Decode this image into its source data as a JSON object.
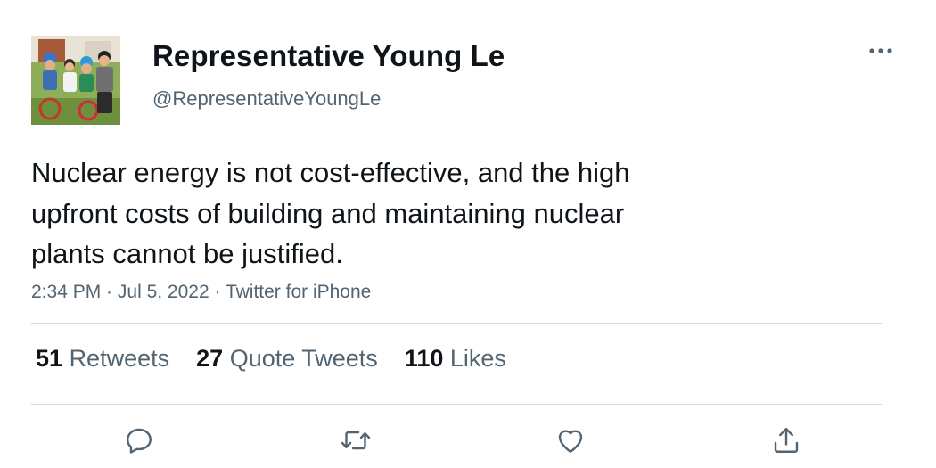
{
  "author": {
    "display_name": "Representative Young Le",
    "handle": "@RepresentativeYoungLe"
  },
  "tweet": {
    "text_lines": [
      "Nuclear energy is not cost-effective, and the high",
      "upfront costs of building and maintaining nuclear",
      "plants cannot be justified."
    ],
    "time": "2:34 PM",
    "separator": " · ",
    "date": "Jul 5, 2022",
    "source": "Twitter for iPhone"
  },
  "stats": {
    "retweets_count": "51",
    "retweets_label": "Retweets",
    "quotes_count": "27",
    "quotes_label": "Quote Tweets",
    "likes_count": "110",
    "likes_label": "Likes"
  },
  "actions": {
    "icons": [
      "reply-icon",
      "retweet-icon",
      "like-icon",
      "share-icon"
    ]
  },
  "colors": {
    "text_primary": "#0f1419",
    "text_secondary": "#536471",
    "divider": "#cfd9de",
    "icon": "#536471"
  }
}
